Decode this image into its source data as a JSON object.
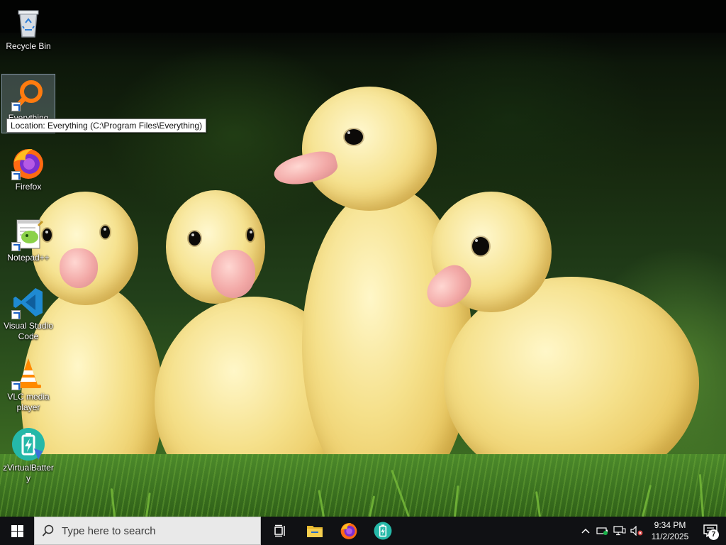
{
  "desktop": {
    "icons": [
      {
        "label": "Recycle Bin",
        "icon": "recycle-bin-icon"
      },
      {
        "label": "Everything",
        "icon": "everything-search-icon"
      },
      {
        "label": "Firefox",
        "icon": "firefox-icon"
      },
      {
        "label": "Notepad++",
        "icon": "notepad-plus-plus-icon"
      },
      {
        "label": "Visual Studio Code",
        "icon": "vscode-icon"
      },
      {
        "label": "VLC media player",
        "icon": "vlc-icon"
      },
      {
        "label": "zVirtualBattery",
        "icon": "zvirtualbattery-icon"
      }
    ],
    "tooltip": "Location: Everything (C:\\Program Files\\Everything)"
  },
  "taskbar": {
    "search_placeholder": "Type here to search",
    "pinned": [
      "task-view-icon",
      "file-explorer-icon",
      "firefox-icon",
      "zvirtualbattery-icon"
    ],
    "clock_time": "9:34 PM",
    "clock_date": "11/2/2025",
    "notification_count": "7"
  },
  "colors": {
    "taskbar": "#101114",
    "selection": "#bed2f0",
    "accent_vscode": "#1f8ad2",
    "accent_firefox": "#ff6a12"
  }
}
